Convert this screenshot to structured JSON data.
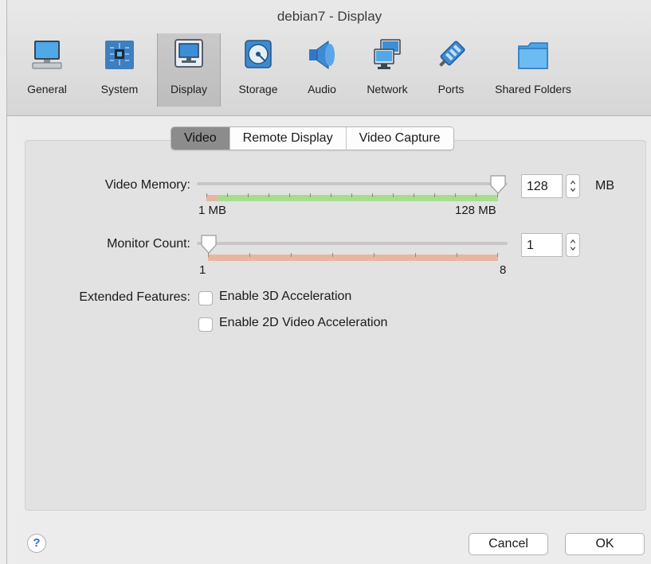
{
  "window": {
    "title": "debian7 - Display"
  },
  "toolbar": {
    "items": [
      {
        "label": "General",
        "icon": "monitor-icon"
      },
      {
        "label": "System",
        "icon": "chip-icon"
      },
      {
        "label": "Display",
        "icon": "display-icon",
        "selected": true
      },
      {
        "label": "Storage",
        "icon": "disk-icon"
      },
      {
        "label": "Audio",
        "icon": "speaker-icon"
      },
      {
        "label": "Network",
        "icon": "network-icon"
      },
      {
        "label": "Ports",
        "icon": "plug-icon"
      },
      {
        "label": "Shared Folders",
        "icon": "folder-icon"
      }
    ]
  },
  "tabs": {
    "items": [
      {
        "label": "Video",
        "active": true
      },
      {
        "label": "Remote Display",
        "active": false
      },
      {
        "label": "Video Capture",
        "active": false
      }
    ]
  },
  "video_memory": {
    "label": "Video Memory:",
    "value": "128",
    "unit": "MB",
    "min_label": "1 MB",
    "max_label": "128 MB",
    "slider_fraction": 1.0
  },
  "monitor_count": {
    "label": "Monitor Count:",
    "value": "1",
    "min_label": "1",
    "max_label": "8",
    "slider_fraction": 0.0
  },
  "extended": {
    "label": "Extended Features:",
    "options": [
      {
        "label": "Enable 3D Acceleration",
        "checked": false
      },
      {
        "label": "Enable 2D Video Acceleration",
        "checked": false
      }
    ]
  },
  "footer": {
    "help": "?",
    "cancel": "Cancel",
    "ok": "OK"
  },
  "colors": {
    "green_scale": "#a6df8c",
    "red_scale": "#e8b5a0",
    "toolbar_bg": "#dcdcdc",
    "panel_bg": "#e2e2e2"
  }
}
